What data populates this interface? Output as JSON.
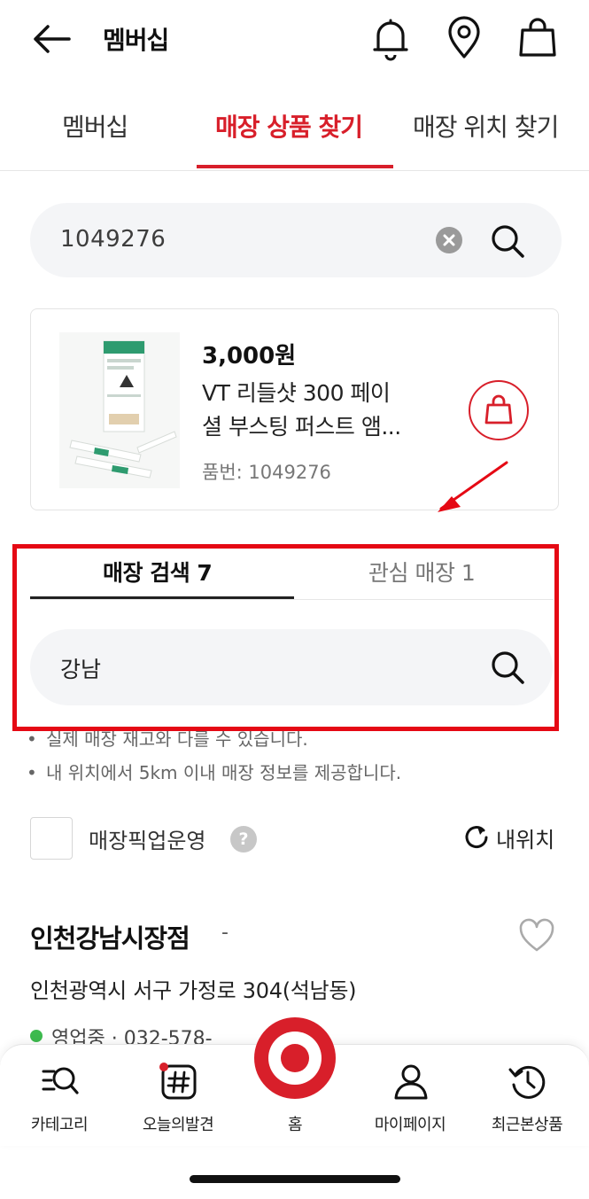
{
  "header": {
    "title": "멤버십"
  },
  "tabs": [
    {
      "label": "멤버십",
      "active": false
    },
    {
      "label": "매장 상품 찾기",
      "active": true
    },
    {
      "label": "매장 위치 찾기",
      "active": false
    }
  ],
  "search": {
    "value": "1049276"
  },
  "product": {
    "price": "3,000원",
    "name_line1": "VT 리들샷 300 페이",
    "name_line2": "셜 부스팅 퍼스트 앰...",
    "code": "품번: 1049276"
  },
  "store_tabs": [
    {
      "label": "매장 검색 7",
      "active": true
    },
    {
      "label": "관심 매장 1",
      "active": false
    }
  ],
  "store_search": {
    "value": "강남"
  },
  "notices": [
    "실제 매장 재고와 다를 수 있습니다.",
    "내 위치에서 5km 이내 매장 정보를 제공합니다."
  ],
  "pickup": {
    "label": "매장픽업운영",
    "help": "?",
    "checked": false
  },
  "my_location": {
    "label": "내위치"
  },
  "store": {
    "name": "인천강남시장점",
    "dash": "-",
    "address": "인천광역시 서구 가정로 304(석남동)",
    "status": "영업중 · 032-578-"
  },
  "bottom_nav": [
    {
      "label": "카테고리",
      "icon": "category-search-icon"
    },
    {
      "label": "오늘의발견",
      "icon": "hashtag-icon"
    },
    {
      "label": "홈",
      "icon": "home-icon"
    },
    {
      "label": "마이페이지",
      "icon": "person-icon"
    },
    {
      "label": "최근본상품",
      "icon": "history-icon"
    }
  ],
  "colors": {
    "accent": "#d81f2a",
    "highlight": "#e50914",
    "status_open": "#3dba4e"
  }
}
